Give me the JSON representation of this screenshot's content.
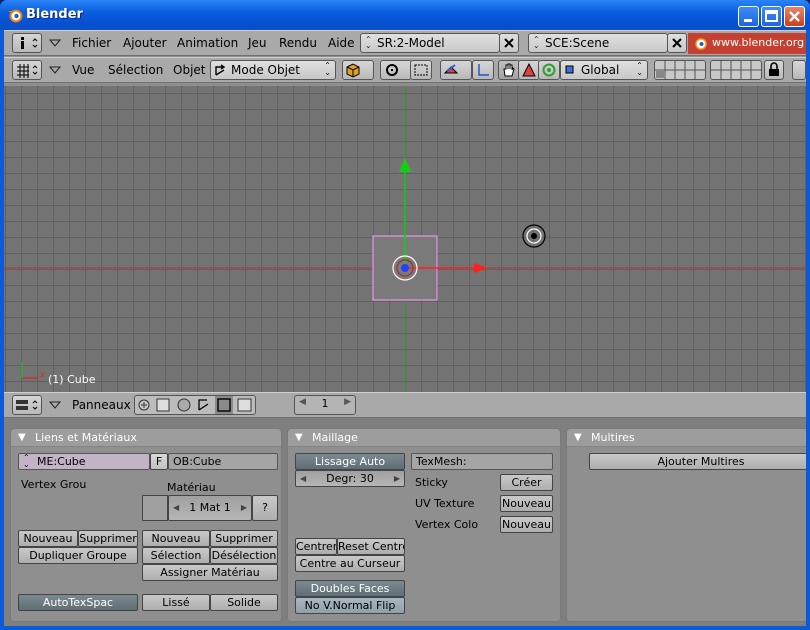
{
  "window": {
    "title": "Blender"
  },
  "info_header": {
    "menus": [
      "Fichier",
      "Ajouter",
      "Animation",
      "Jeu",
      "Rendu",
      "Aide"
    ],
    "screen": "SR:2-Model",
    "scene": "SCE:Scene",
    "url": "www.blender.org"
  },
  "view_header": {
    "menus": [
      "Vue",
      "Sélection",
      "Objet"
    ],
    "mode": "Mode Objet",
    "orientation": "Global"
  },
  "viewport": {
    "object_label": "(1) Cube"
  },
  "buttons_header": {
    "panels_label": "Panneaux",
    "frame": "1"
  },
  "panel_links": {
    "title": "Liens et Matériaux",
    "mesh_name": "ME:Cube",
    "f_label": "F",
    "object_name": "OB:Cube",
    "vertex_group_label": "Vertex Grou",
    "material_label": "Matériau",
    "mat_selector": "1 Mat 1",
    "question": "?",
    "btn_nouveau_vg": "Nouveau",
    "btn_supprimer_vg": "Supprimer",
    "btn_dupliquer_groupe": "Dupliquer Groupe",
    "btn_nouveau_mat": "Nouveau",
    "btn_supprimer_mat": "Supprimer",
    "btn_selection": "Sélection",
    "btn_deselection": "Désélection",
    "btn_assigner": "Assigner Matériau",
    "btn_autotexspace": "AutoTexSpac",
    "btn_lisse": "Lissé",
    "btn_solide": "Solide"
  },
  "panel_mesh": {
    "title": "Maillage",
    "btn_lissage_auto": "Lissage Auto",
    "degr": "Degr: 30",
    "texmesh": "TexMesh:",
    "sticky_label": "Sticky",
    "btn_creer": "Créer",
    "uv_label": "UV Texture",
    "btn_uv_nouveau": "Nouveau",
    "vcol_label": "Vertex Colo",
    "btn_vcol_nouveau": "Nouveau",
    "btn_centrer": "Centrer",
    "btn_reset_centre": "Reset Centre",
    "btn_centre_curseur": "Centre au Curseur",
    "btn_doubles_faces": "Doubles Faces",
    "btn_no_vnormal_flip": "No V.Normal Flip"
  },
  "panel_multires": {
    "title": "Multires",
    "btn_ajouter": "Ajouter Multires"
  },
  "colors": {
    "titlebar": "#0a5fe0",
    "viewport_bg": "#737373",
    "axis_x": "#ff2020",
    "axis_y": "#20c020",
    "selection": "#ff88ff"
  }
}
